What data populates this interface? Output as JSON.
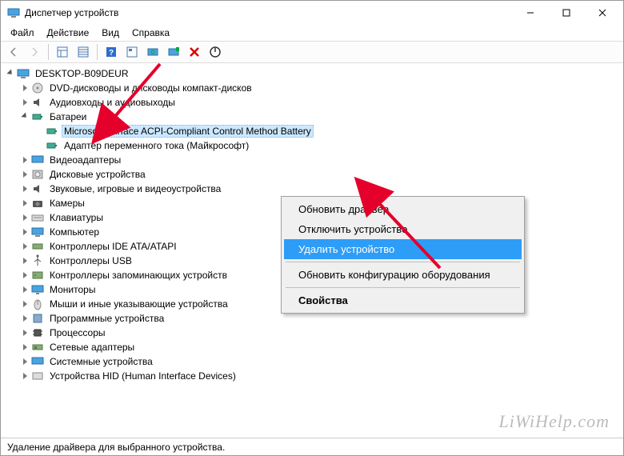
{
  "window": {
    "title": "Диспетчер устройств"
  },
  "menus": {
    "file": "Файл",
    "action": "Действие",
    "view": "Вид",
    "help": "Справка"
  },
  "tree": {
    "root": "DESKTOP-B09DEUR",
    "cat_dvd": "DVD-дисководы и дисководы компакт-дисков",
    "cat_audio": "Аудиовходы и аудиовыходы",
    "cat_battery": "Батареи",
    "battery_acpi": "Microsoft Surface ACPI-Compliant Control Method Battery",
    "battery_adapter": "Адаптер переменного тока (Майкрософт)",
    "cat_video": "Видеоадаптеры",
    "cat_disk": "Дисковые устройства",
    "cat_soundvideo": "Звуковые, игровые и видеоустройства",
    "cat_cameras": "Камеры",
    "cat_keyboards": "Клавиатуры",
    "cat_computer": "Компьютер",
    "cat_ide": "Контроллеры IDE ATA/ATAPI",
    "cat_usb": "Контроллеры USB",
    "cat_storage": "Контроллеры запоминающих устройств",
    "cat_monitors": "Мониторы",
    "cat_mice": "Мыши и иные указывающие устройства",
    "cat_software": "Программные устройства",
    "cat_cpu": "Процессоры",
    "cat_network": "Сетевые адаптеры",
    "cat_system": "Системные устройства",
    "cat_hid": "Устройства HID (Human Interface Devices)"
  },
  "context": {
    "update": "Обновить драйвер",
    "disable": "Отключить устройство",
    "uninstall": "Удалить устройство",
    "scan": "Обновить конфигурацию оборудования",
    "properties": "Свойства"
  },
  "status": "Удаление драйвера для выбранного устройства.",
  "watermark": "LiWiHelp.com"
}
